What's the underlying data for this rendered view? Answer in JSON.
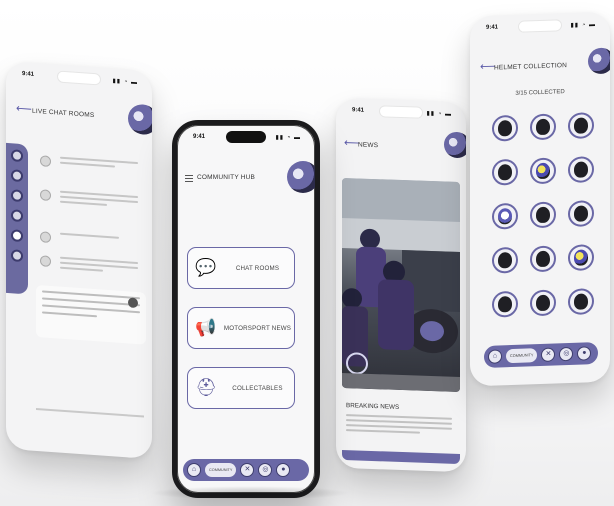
{
  "colors": {
    "accent": "#6a68a6",
    "frame": "#1b1b1d",
    "background": "#ffffff"
  },
  "chat_phone": {
    "time": "9:41",
    "title": "LIVE CHAT ROOMS",
    "sidebar_icon": "room-icon"
  },
  "hub_phone": {
    "time": "9:41",
    "title": "COMMUNITY HUB",
    "buttons": [
      {
        "label": "CHAT ROOMS",
        "icon": "chat-bubbles-icon"
      },
      {
        "label": "MOTORSPORT NEWS",
        "icon": "megaphone-icon"
      },
      {
        "label": "COLLECTABLES",
        "icon": "helmet-icon"
      }
    ],
    "nav_pill": "COMMUNITY"
  },
  "news_phone": {
    "time": "9:41",
    "title": "NEWS",
    "card_title": "BREAKING NEWS"
  },
  "helmet_phone": {
    "time": "9:41",
    "title": "HELMET COLLECTION",
    "collected": "3/15 COLLECTED",
    "nav_pill": "COMMUNITY"
  }
}
